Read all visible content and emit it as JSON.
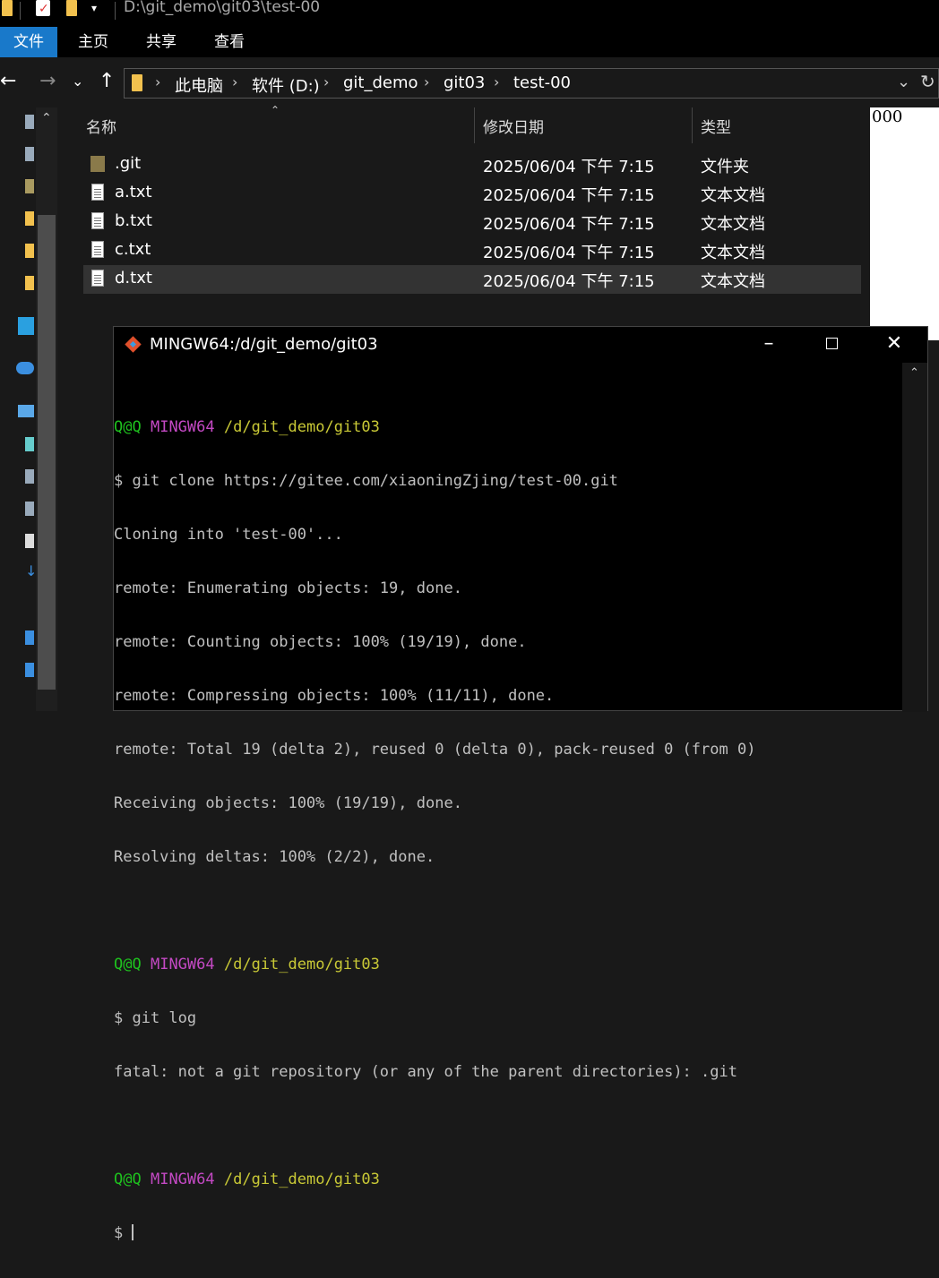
{
  "window": {
    "title_path": "D:\\git_demo\\git03\\test-00"
  },
  "ribbon": {
    "tabs": [
      "文件",
      "主页",
      "共享",
      "查看"
    ]
  },
  "address": {
    "crumbs": [
      "此电脑",
      "软件 (D:)",
      "git_demo",
      "git03",
      "test-00"
    ]
  },
  "columns": {
    "name": "名称",
    "date": "修改日期",
    "type": "类型"
  },
  "files": [
    {
      "name": ".git",
      "date": "2025/06/04 下午 7:15",
      "type": "文件夹",
      "icon": "folder-icon"
    },
    {
      "name": "a.txt",
      "date": "2025/06/04 下午 7:15",
      "type": "文本文档",
      "icon": "text-file-icon"
    },
    {
      "name": "b.txt",
      "date": "2025/06/04 下午 7:15",
      "type": "文本文档",
      "icon": "text-file-icon"
    },
    {
      "name": "c.txt",
      "date": "2025/06/04 下午 7:15",
      "type": "文本文档",
      "icon": "text-file-icon"
    },
    {
      "name": "d.txt",
      "date": "2025/06/04 下午 7:15",
      "type": "文本文档",
      "icon": "text-file-icon",
      "selected": true
    }
  ],
  "preview": {
    "text": "000"
  },
  "terminal": {
    "title": "MINGW64:/d/git_demo/git03",
    "prompt_user": "Q@Q",
    "prompt_env": "MINGW64",
    "prompt_path": "/d/git_demo/git03",
    "lines": [
      "$ git clone https://gitee.com/xiaoningZjing/test-00.git",
      "Cloning into 'test-00'...",
      "remote: Enumerating objects: 19, done.",
      "remote: Counting objects: 100% (19/19), done.",
      "remote: Compressing objects: 100% (11/11), done.",
      "remote: Total 19 (delta 2), reused 0 (delta 0), pack-reused 0 (from 0)",
      "Receiving objects: 100% (19/19), done.",
      "Resolving deltas: 100% (2/2), done.",
      "$ git log",
      "fatal: not a git repository (or any of the parent directories): .git",
      "$ "
    ]
  },
  "colors": {
    "accent": "#1979ca",
    "prompt_green": "#1ec21e",
    "prompt_magenta": "#c449c4",
    "prompt_yellow": "#c9c936"
  }
}
